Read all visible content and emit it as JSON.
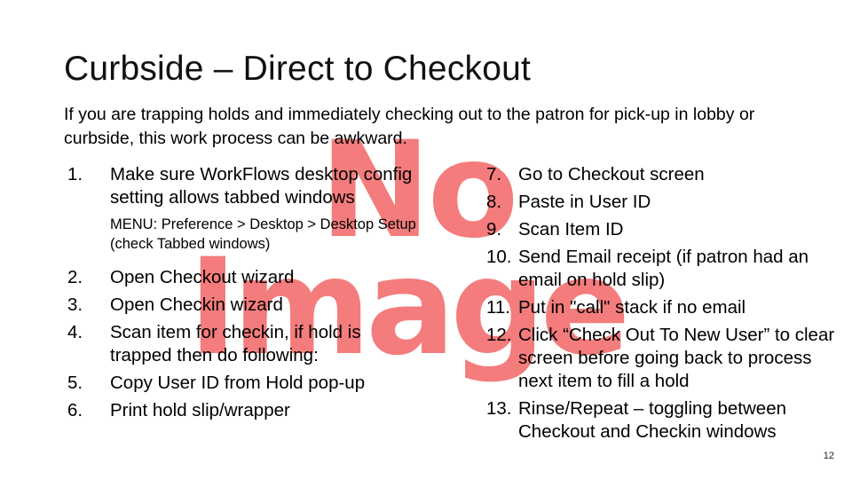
{
  "slide": {
    "title": "Curbside – Direct to Checkout",
    "intro": "If you are trapping holds and immediately checking out to the patron for pick-up in lobby or curbside, this work process can be awkward.",
    "page_number": "12",
    "watermark": {
      "line1": "No",
      "line2": "Image",
      "color": "#f47c7c"
    }
  },
  "steps_left": [
    {
      "num": "1.",
      "text": "Make sure WorkFlows desktop config setting allows tabbed windows",
      "note": "MENU: Preference > Desktop > Desktop Setup (check Tabbed windows)"
    },
    {
      "num": "2.",
      "text": "Open Checkout wizard"
    },
    {
      "num": "3.",
      "text": "Open Checkin wizard"
    },
    {
      "num": "4.",
      "text": "Scan item for checkin, if hold is trapped then do following:"
    },
    {
      "num": "5.",
      "text": "Copy User ID from Hold pop-up"
    },
    {
      "num": "6.",
      "text": "Print hold slip/wrapper"
    }
  ],
  "steps_right": [
    {
      "num": "7.",
      "text": "Go to Checkout screen"
    },
    {
      "num": "8.",
      "text": "Paste in User ID"
    },
    {
      "num": "9.",
      "text": "Scan Item ID"
    },
    {
      "num": "10.",
      "text": "Send Email receipt (if patron had an email on hold slip)"
    },
    {
      "num": "11.",
      "text": "Put in \"call\" stack if no email"
    },
    {
      "num": "12.",
      "text": "Click “Check Out To  New User” to clear screen before going back to process next item to fill a hold"
    },
    {
      "num": "13.",
      "text": "Rinse/Repeat – toggling between Checkout and Checkin windows"
    }
  ]
}
